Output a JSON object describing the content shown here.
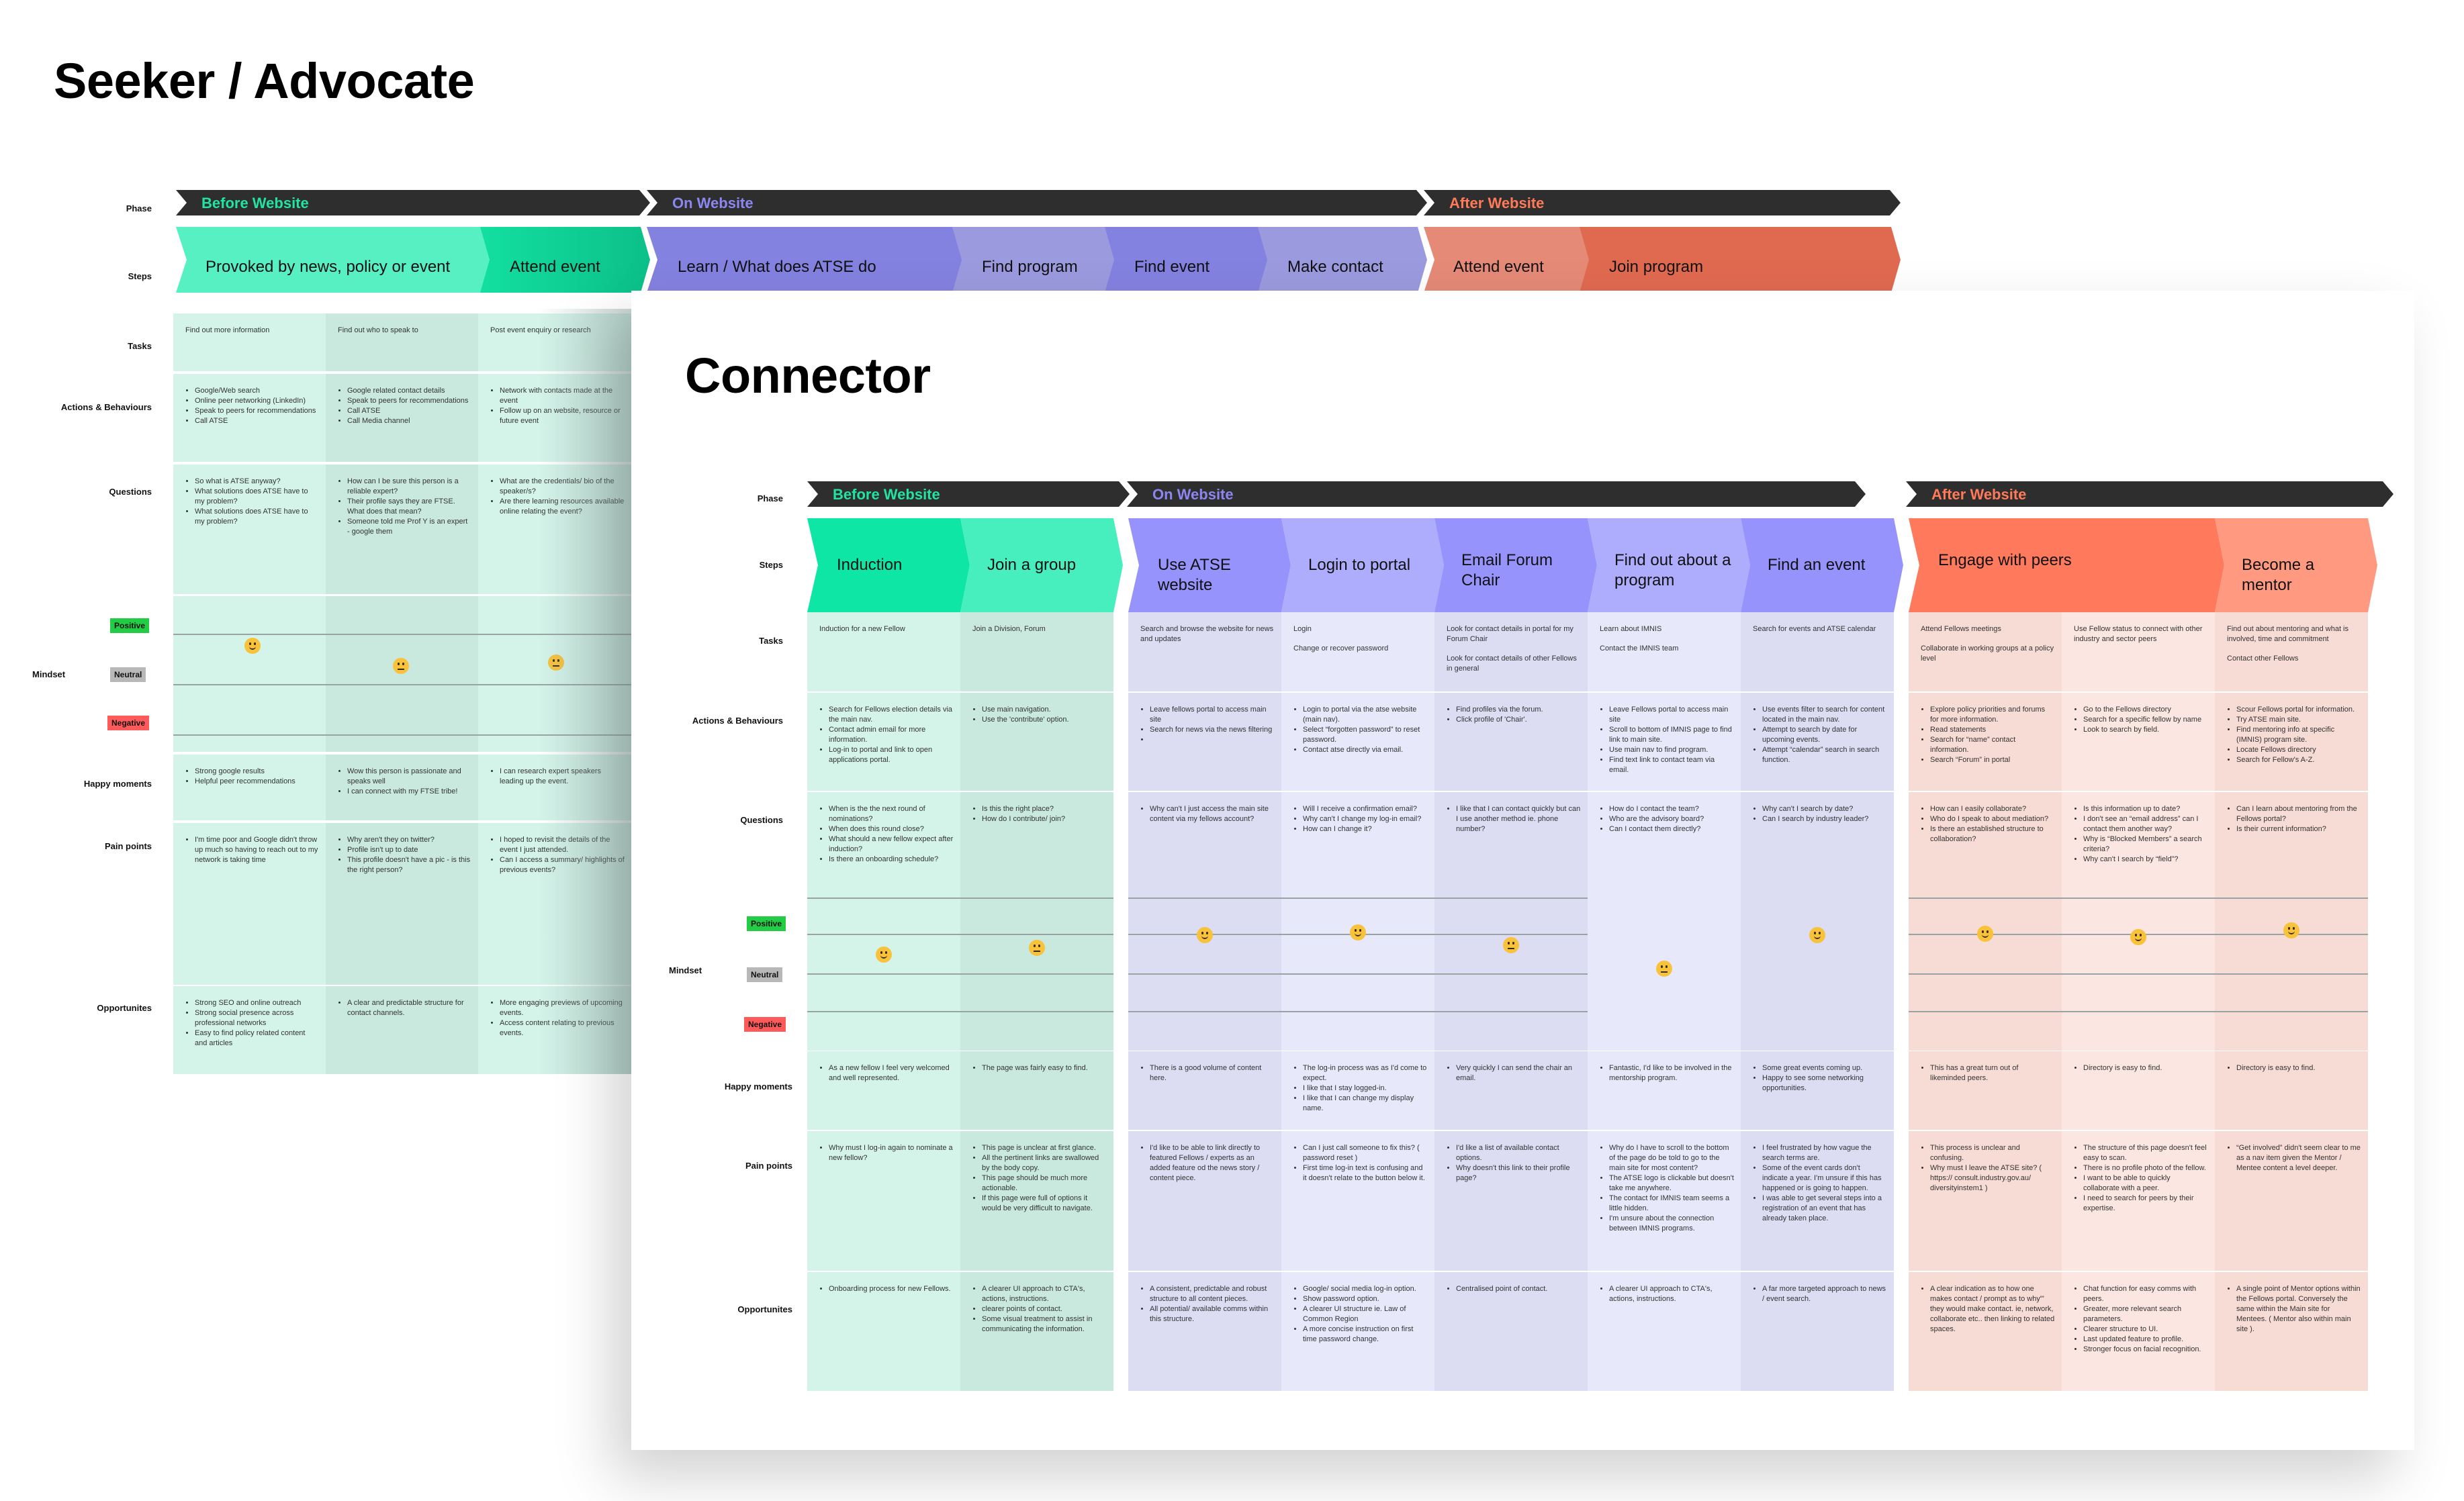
{
  "boards": {
    "seeker": {
      "title": "Seeker / Advocate",
      "row_labels": {
        "phase": "Phase",
        "steps": "Steps",
        "tasks": "Tasks",
        "actions": "Actions & Behaviours",
        "questions": "Questions",
        "mindset": "Mindset",
        "happy": "Happy moments",
        "pain": "Pain points",
        "opportunities": "Opportunites"
      },
      "mindset_scale": {
        "positive": "Positive",
        "neutral": "Neutral",
        "negative": "Negative"
      },
      "phases": [
        {
          "label": "Before Website",
          "color": "#22e3a4"
        },
        {
          "label": "On Website",
          "color": "#8c87f0"
        },
        {
          "label": "After Website",
          "color": "#ff7a59"
        }
      ],
      "steps": [
        {
          "label": "Provoked by news, policy or event",
          "phase": 0
        },
        {
          "label": "Attend event",
          "phase": 0
        },
        {
          "label": "Learn / What does ATSE do",
          "phase": 1
        },
        {
          "label": "Find program",
          "phase": 1
        },
        {
          "label": "Find event",
          "phase": 1
        },
        {
          "label": "Make contact",
          "phase": 1
        },
        {
          "label": "Attend event",
          "phase": 2
        },
        {
          "label": "Join program",
          "phase": 2
        }
      ],
      "columns": [
        {
          "tasks": [
            "Find out more information"
          ],
          "actions": [
            "Google/Web search",
            "Online peer networking (LinkedIn)",
            "Speak to peers for recommendations",
            "Call ATSE"
          ],
          "questions": [
            "So what is ATSE anyway?",
            "What solutions does ATSE have to my problem?",
            "What solutions does ATSE have to my problem?"
          ],
          "mindset": "positive-mid",
          "happy": [
            "Strong google results",
            "Helpful peer recommendations"
          ],
          "pain": [
            "I'm time poor and Google didn't throw up much so having to reach out to my network is taking time"
          ],
          "opportunities": [
            "Strong SEO and online outreach",
            "Strong social presence across professional networks",
            "Easy to find policy related content and articles"
          ]
        },
        {
          "tasks": [
            "Find out who to speak to"
          ],
          "actions": [
            "Google related contact details",
            "Speak to peers for recommendations",
            "Call ATSE",
            "Call Media channel"
          ],
          "questions": [
            "How can I be sure this person is a reliable expert?",
            "Their profile says they are FTSE. What does that mean?",
            "Someone told me Prof Y is an expert - google them"
          ],
          "mindset": "neutral",
          "happy": [
            "Wow this person is passionate and speaks well",
            "I can connect with my FTSE tribe!"
          ],
          "pain": [
            "Why aren't they on twitter?",
            "Profile isn't up to date",
            "This profile doesn't have a pic - is this the right person?"
          ],
          "opportunities": [
            "A clear and predictable structure for contact channels."
          ]
        },
        {
          "tasks": [
            "Post event enquiry or research"
          ],
          "actions": [
            "Network with contacts made at the event",
            "Follow up on an website, resource or future event"
          ],
          "questions": [
            "What are the credentials/ bio of the speaker/s?",
            "Are there learning resources available online relating the event?"
          ],
          "mindset": "neutral",
          "happy": [
            "I can research expert speakers leading up the event."
          ],
          "pain": [
            "I hoped to revisit the details of the event I just attended.",
            "Can I access a summary/ highlights of previous events?"
          ],
          "opportunities": [
            "More engaging previews of upcoming events.",
            "Access content relating to previous events."
          ]
        }
      ]
    },
    "connector": {
      "title": "Connector",
      "row_labels": {
        "phase": "Phase",
        "steps": "Steps",
        "tasks": "Tasks",
        "actions": "Actions & Behaviours",
        "questions": "Questions",
        "mindset": "Mindset",
        "happy": "Happy moments",
        "pain": "Pain points",
        "opportunities": "Opportunites"
      },
      "mindset_scale": {
        "positive": "Positive",
        "neutral": "Neutral",
        "negative": "Negative"
      },
      "phases": [
        {
          "label": "Before Website",
          "color": "#22e3a4"
        },
        {
          "label": "On Website",
          "color": "#8c87f0"
        },
        {
          "label": "After Website",
          "color": "#ff7a59"
        }
      ],
      "columns": [
        {
          "phase": 0,
          "step": "Induction",
          "tasks": [
            "Induction for a new Fellow"
          ],
          "actions": [
            "Search for Fellows election details via the main nav.",
            "Contact admin email for more information.",
            "Log-in to portal and link to open applications portal."
          ],
          "questions": [
            "When is the the next round of nominations?",
            "When does this round close?",
            "What should a new fellow expect after induction?",
            "Is there an onboarding schedule?"
          ],
          "mindset": "happy",
          "mindset_level": 0.62,
          "happy": [
            "As a new fellow I feel very welcomed and well represented."
          ],
          "pain": [
            "Why must I log-in again to nominate a new fellow?"
          ],
          "opportunities": [
            "Onboarding process for new Fellows."
          ]
        },
        {
          "phase": 0,
          "step": "Join a group",
          "tasks": [
            "Join a Division, Forum"
          ],
          "actions": [
            "Use main navigation.",
            "Use the 'contribute' option."
          ],
          "questions": [
            "Is this the right place?",
            "How do I contribute/ join?"
          ],
          "mindset": "neutral",
          "mindset_level": 0.66,
          "happy": [
            "The page was fairly easy to find."
          ],
          "pain": [
            "This page is unclear at first glance.",
            "All the pertinent links are swallowed by the body copy.",
            "This page should be much more actionable.",
            "If this page were full of options it would be very difficult to navigate."
          ],
          "opportunities": [
            "A clearer UI approach to CTA's, actions, instructions.",
            "clearer points of contact.",
            "Some visual treatment to assist in communicating the information."
          ]
        },
        {
          "phase": 1,
          "step": "Use ATSE website",
          "tasks": [
            "Search and browse the website for news and updates"
          ],
          "actions": [
            "Leave fellows portal to access main site",
            "Search for news via the news filtering",
            ""
          ],
          "questions": [
            "Why can't I just access the main site content via my fellows account?"
          ],
          "mindset": "happy",
          "mindset_level": 0.74,
          "happy": [
            "There is a good volume of content here."
          ],
          "pain": [
            "I'd like to be able to link directly to featured Fellows / experts as an added feature od the news story / content piece."
          ],
          "opportunities": [
            "A consistent, predictable and robust structure to all content pieces.",
            "All potential/ available comms within this structure."
          ]
        },
        {
          "phase": 1,
          "step": "Login to portal",
          "tasks": [
            "Login",
            "Change or recover password"
          ],
          "actions": [
            "Login to portal via the atse website (main nav).",
            "Select “forgotten password” to reset password.",
            "Contact atse directly via email."
          ],
          "questions": [
            "Will I receive a confirmation email?",
            "Why can't I change my log-in email?",
            "How can I change it?"
          ],
          "mindset": "happy",
          "mindset_level": 0.76,
          "happy": [
            "The log-in process was as I'd come to expect.",
            "I like that I stay logged-in.",
            "I like that I can change my display name."
          ],
          "pain": [
            "Can I just call someone to fix this? ( password reset )",
            "First time log-in text is confusing and it doesn't relate to the button below it."
          ],
          "opportunities": [
            "Google/ social media log-in option.",
            "Show password option.",
            "A clearer UI structure ie. Law of Common Region",
            "A more concise instruction on first time password change."
          ]
        },
        {
          "phase": 1,
          "step": "Email Forum Chair",
          "tasks": [
            "Look for contact details in portal for my Forum Chair",
            "Look for contact details of other Fellows in general"
          ],
          "actions": [
            "Find profiles via the forum.",
            "Click profile of 'Chair'."
          ],
          "questions": [
            "I like that I can contact quickly but can I use another method ie. phone number?"
          ],
          "mindset": "neutral",
          "mindset_level": 0.68,
          "happy": [
            "Very quickly I can send the chair an email."
          ],
          "pain": [
            "I'd like a list of available contact options.",
            "Why doesn't this link to their profile page?"
          ],
          "opportunities": [
            "Centralised point of contact."
          ]
        },
        {
          "phase": 1,
          "step": "Find out about a program",
          "tasks": [
            "Learn about IMNIS",
            "Contact the IMNIS team"
          ],
          "actions": [
            "Leave Fellows portal to access main site",
            "Scroll to bottom of IMNIS page to find link to main site.",
            "Use main nav to find program.",
            "Find text link to contact team via email."
          ],
          "questions": [
            "How do I contact the team?",
            "Who are the advisory board?",
            "Can I contact them directly?"
          ],
          "mindset": "neutral",
          "mindset_level": 0.53,
          "happy": [
            "Fantastic, I'd like to be involved in the mentorship program."
          ],
          "pain": [
            "Why do I have to scroll to the bottom of the page do be told to go to the main site for most content?",
            "The ATSE logo is clickable but doesn't take me anywhere.",
            "The contact for IMNIS team seems a little hidden.",
            "I'm unsure about the connection between IMNIS programs."
          ],
          "opportunities": [
            "A clearer UI approach to CTA's, actions, instructions."
          ]
        },
        {
          "phase": 1,
          "step": "Find an event",
          "tasks": [
            "Search for events and ATSE calendar"
          ],
          "actions": [
            "Use events filter to search for content located in the main nav.",
            "Attempt to search by date for upcoming events.",
            "Attempt “calendar” search in search function."
          ],
          "questions": [
            "Why can't I search by date?",
            "Can I search by industry leader?"
          ],
          "mindset": "happy",
          "mindset_level": 0.74,
          "happy": [
            "Some great events coming up.",
            "Happy to see some networking opportunities."
          ],
          "pain": [
            "I feel frustrated by how vague the search terms are.",
            "Some of the event cards don't indicate a year. I'm unsure if this has happened or is going to happen.",
            "I was able to get several steps into a registration of an event that has already taken place."
          ],
          "opportunities": [
            "A far more targeted approach to news / event search."
          ]
        },
        {
          "phase": 2,
          "step": "Engage with peers",
          "tasks": [
            "Attend Fellows meetings",
            "Collaborate in working groups at a policy level"
          ],
          "actions": [
            "Explore policy priorities and forums for more information.",
            "Read statements",
            "Search for “name” contact information.",
            "Search “Forum” in portal"
          ],
          "questions": [
            "How can I easily collaborate?",
            "Who do I speak to about mediation?",
            "Is there an established structure to collaboration?"
          ],
          "mindset": "happy",
          "mindset_level": 0.75,
          "happy": [
            "This has a great turn out of likeminded peers."
          ],
          "pain": [
            "This process is unclear and confusing.",
            "Why must I leave the ATSE site? ( https:// consult.industry.gov.au/ diversityinstem1 )"
          ],
          "opportunities": [
            "A clear indication as to how one makes contact / prompt as to why\"' they would make contact. ie, network, collaborate etc.. then linking to related spaces."
          ]
        },
        {
          "phase": 2,
          "step": "",
          "tasks": [
            "Use Fellow status to connect with other industry and sector peers"
          ],
          "actions": [
            "Go to the Fellows directory",
            "Search for a specific fellow by name",
            "Look to search by field."
          ],
          "questions": [
            "Is this information up to date?",
            "I don't see an “email address” can I contact them another way?",
            "Why is “Blocked Members” a search criteria?",
            "Why can't I search by “field”?"
          ],
          "mindset": "happy",
          "mindset_level": 0.73,
          "happy": [
            "Directory is easy to find."
          ],
          "pain": [
            "The structure of this page doesn't feel easy to scan.",
            "There is no profile photo of the fellow.",
            "I want to be able to quickly collaborate with a peer.",
            "I need to search for peers by their expertise."
          ],
          "opportunities": [
            "Chat function for easy comms with peers.",
            "Greater, more relevant search parameters.",
            "Clearer structure to UI.",
            "Last updated feature to profile.",
            "Stronger focus on facial recognition."
          ]
        },
        {
          "phase": 2,
          "step": "Become a mentor",
          "tasks": [
            "Find out about mentoring and what is involved, time and commitment",
            "Contact other Fellows"
          ],
          "actions": [
            "Scour Fellows portal for information.",
            "Try ATSE main site.",
            "Find mentoring info at specific (IMNIS) program site.",
            "Locate Fellows directory",
            "Search for Fellow's A-Z."
          ],
          "questions": [
            "Can I learn about mentoring from the Fellows portal?",
            "Is their current information?"
          ],
          "mindset": "happy",
          "mindset_level": 0.77,
          "happy": [
            "Directory is easy to find."
          ],
          "pain": [
            "“Get involved” didn't seem clear to me as a nav item given the Mentor / Mentee content a level deeper."
          ],
          "opportunities": [
            "A single point of Mentor options within the Fellows portal. Conversely the same within the Main site for Mentees. ( Mentor also within main site )."
          ]
        }
      ]
    }
  },
  "colors": {
    "phase_bar": "#2e2e2e",
    "positive_badge": "#22cc44",
    "neutral_badge": "#b8b8b8",
    "negative_badge": "#ff5a5a",
    "emoji": "#f8c23a"
  }
}
